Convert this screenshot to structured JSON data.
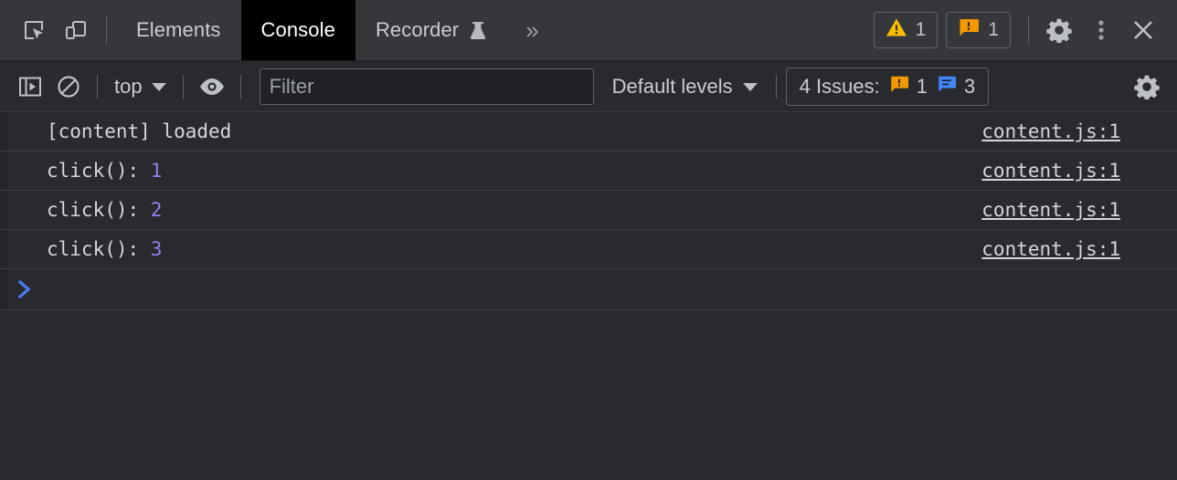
{
  "tabbar": {
    "inspect_icon": "inspect-element-icon",
    "device_icon": "device-toolbar-icon",
    "tabs": [
      {
        "label": "Elements",
        "active": false,
        "icon": null
      },
      {
        "label": "Console",
        "active": true,
        "icon": null
      },
      {
        "label": "Recorder",
        "active": false,
        "icon": "flask-icon"
      }
    ],
    "more_tabs_label": "»",
    "warning_count": "1",
    "issue_count": "1",
    "settings_icon": "gear-icon",
    "more_options_icon": "kebab-menu-icon",
    "close_icon": "close-icon"
  },
  "toolbar": {
    "sidebar_toggle_icon": "console-sidebar-icon",
    "clear_icon": "clear-console-icon",
    "context_label": "top",
    "eye_icon": "live-expression-icon",
    "filter_placeholder": "Filter",
    "filter_value": "",
    "levels_label": "Default levels",
    "issues_label": "4 Issues:",
    "issues_warning_count": "1",
    "issues_info_count": "3",
    "settings_icon": "gear-icon"
  },
  "console": {
    "messages": [
      {
        "text": "[content] loaded",
        "value": "",
        "source": "content.js:1"
      },
      {
        "text": "click(): ",
        "value": "1",
        "source": "content.js:1"
      },
      {
        "text": "click(): ",
        "value": "2",
        "source": "content.js:1"
      },
      {
        "text": "click(): ",
        "value": "3",
        "source": "content.js:1"
      }
    ],
    "prompt_symbol": "›"
  },
  "colors": {
    "warning_yellow": "#fbbc04",
    "issue_orange": "#f29900",
    "info_blue": "#4285f4",
    "prompt_blue": "#4a7cf0",
    "number_purple": "#9a7fee",
    "active_tab_bg": "#000000",
    "panel_bg": "#282a2d",
    "tabbar_bg": "#35373a"
  }
}
